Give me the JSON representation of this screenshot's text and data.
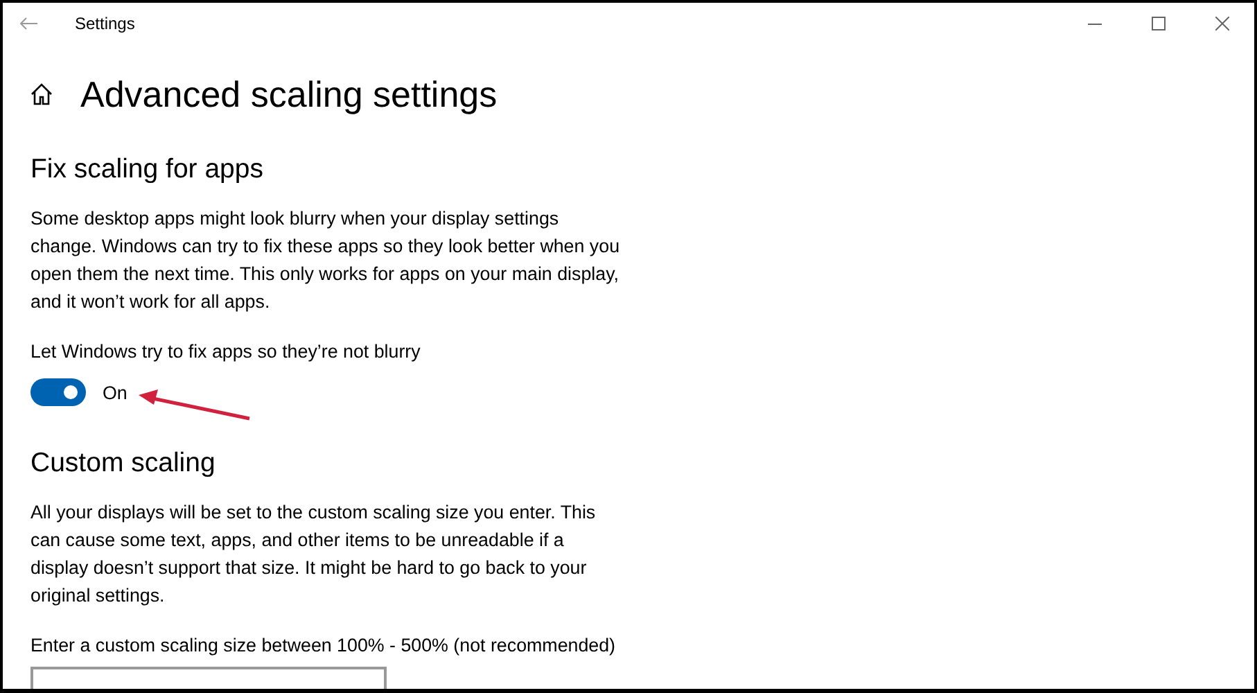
{
  "window": {
    "title": "Settings"
  },
  "page": {
    "title": "Advanced scaling settings"
  },
  "fix_scaling": {
    "heading": "Fix scaling for apps",
    "description": "Some desktop apps might look blurry when your display settings change. Windows can try to fix these apps so they look better when you open them the next time. This only works for apps on your main display, and it won’t work for all apps.",
    "toggle": {
      "label": "Let Windows try to fix apps so they’re not blurry",
      "on": true,
      "state_text": "On"
    }
  },
  "custom_scaling": {
    "heading": "Custom scaling",
    "description": "All your displays will be set to the custom scaling size you enter. This can cause some text, apps, and other items to be unreadable if a display doesn’t support that size. It might be hard to go back to your original settings.",
    "field_label": "Enter a custom scaling size between 100% - 500% (not recommended)"
  }
}
